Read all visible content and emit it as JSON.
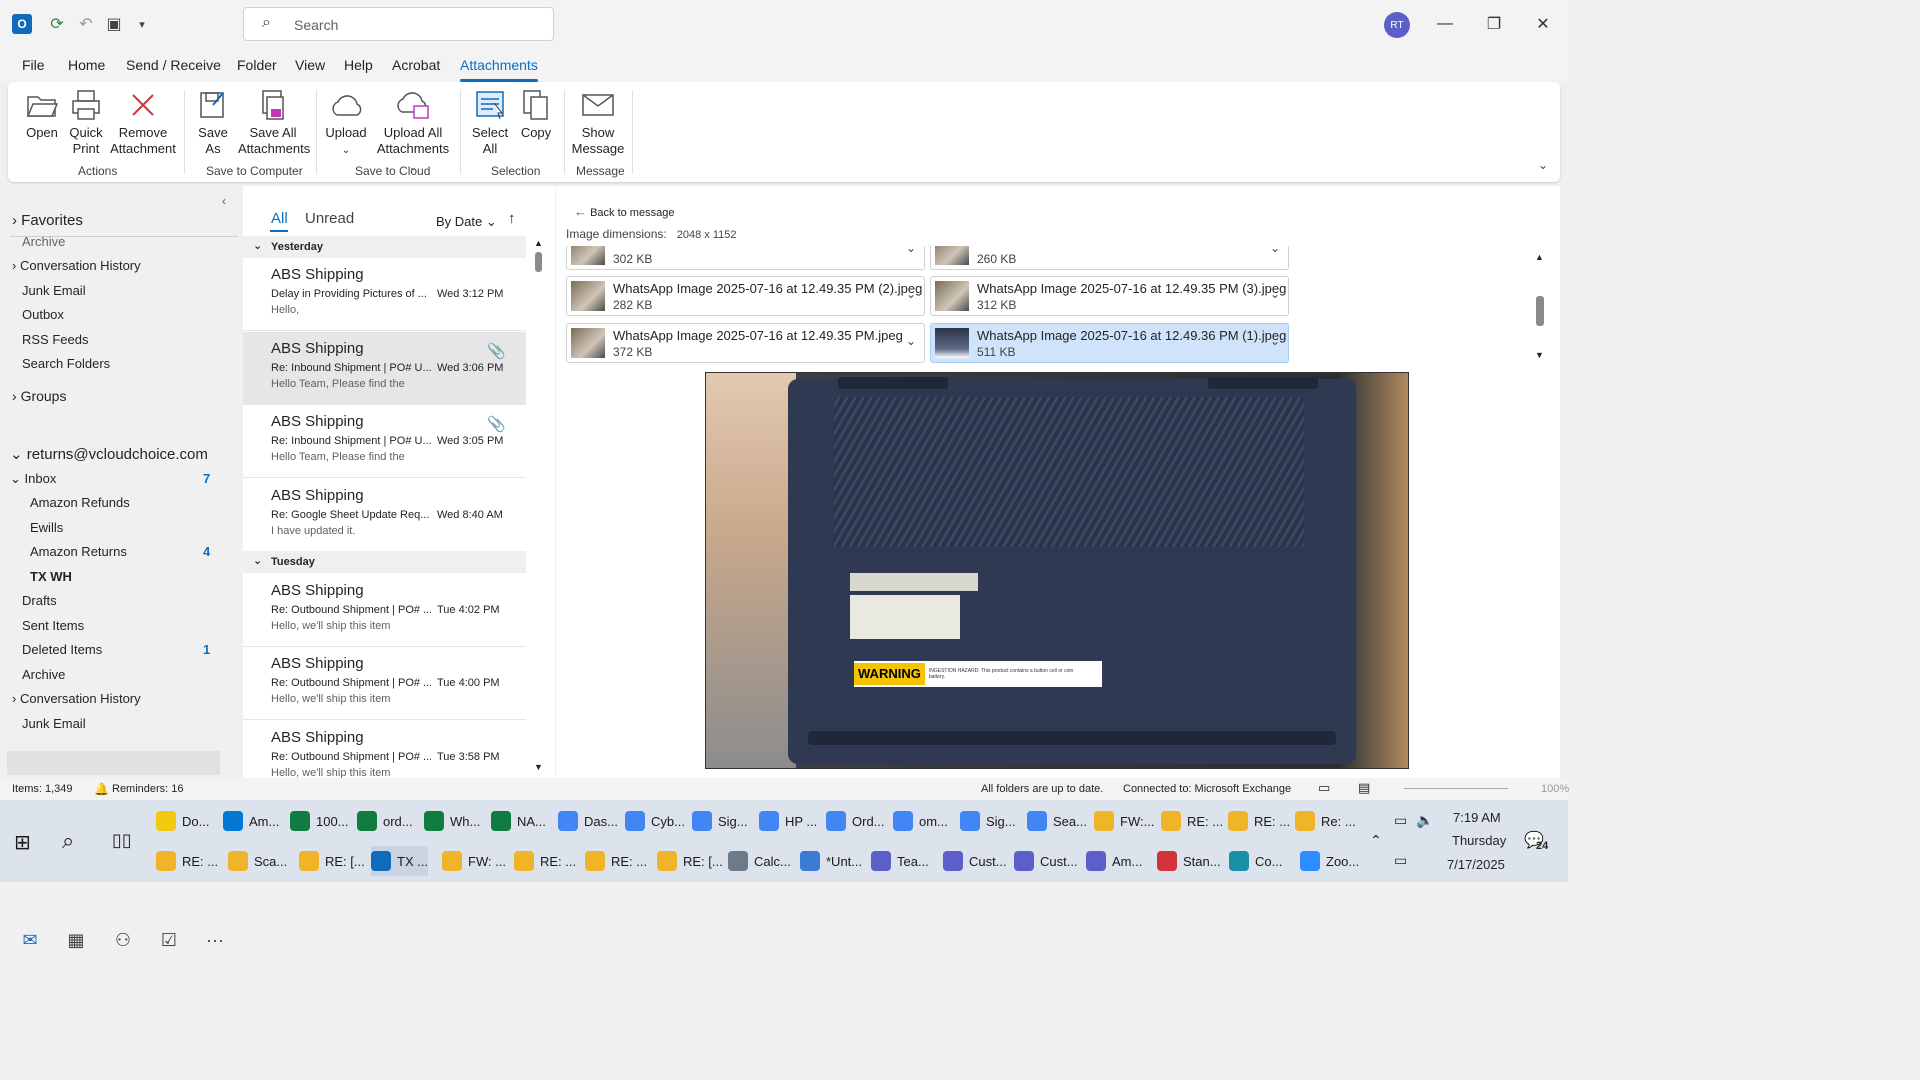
{
  "titlebar": {
    "search_placeholder": "Search",
    "avatar_initials": "RT"
  },
  "menu": {
    "tabs": [
      {
        "label": "File"
      },
      {
        "label": "Home"
      },
      {
        "label": "Send / Receive"
      },
      {
        "label": "Folder"
      },
      {
        "label": "View"
      },
      {
        "label": "Help"
      },
      {
        "label": "Acrobat"
      },
      {
        "label": "Attachments"
      }
    ]
  },
  "ribbon": {
    "open": "Open",
    "quick_print_1": "Quick",
    "quick_print_2": "Print",
    "remove_1": "Remove",
    "remove_2": "Attachment",
    "save_as_1": "Save",
    "save_as_2": "As",
    "save_all_1": "Save All",
    "save_all_2": "Attachments",
    "upload": "Upload",
    "upload_all_1": "Upload All",
    "upload_all_2": "Attachments",
    "select_all_1": "Select",
    "select_all_2": "All",
    "copy": "Copy",
    "show_msg_1": "Show",
    "show_msg_2": "Message",
    "groups": {
      "actions": "Actions",
      "save_computer": "Save to Computer",
      "save_cloud": "Save to Cloud",
      "selection": "Selection",
      "message": "Message"
    }
  },
  "folders": {
    "favorites": "Favorites",
    "archive_top": "Archive",
    "conv_history": "Conversation History",
    "junk": "Junk Email",
    "outbox": "Outbox",
    "rss": "RSS Feeds",
    "search_folders": "Search Folders",
    "groups": "Groups",
    "account": "returns@vcloudchoice.com",
    "inbox": "Inbox",
    "inbox_count": "7",
    "amazon_refunds": "Amazon Refunds",
    "ewills": "Ewills",
    "amazon_returns": "Amazon Returns",
    "amazon_returns_count": "4",
    "tx_wh": "TX WH",
    "drafts": "Drafts",
    "sent": "Sent Items",
    "deleted": "Deleted Items",
    "deleted_count": "1",
    "archive": "Archive",
    "conv_history2": "Conversation History",
    "junk2": "Junk Email"
  },
  "list": {
    "tab_all": "All",
    "tab_unread": "Unread",
    "sort": "By Date",
    "group_yesterday": "Yesterday",
    "group_tuesday": "Tuesday",
    "messages": [
      {
        "from": "ABS Shipping",
        "subject": "Delay in Providing Pictures of ...",
        "date": "Wed 3:12 PM",
        "preview": "Hello,"
      },
      {
        "from": "ABS Shipping",
        "subject": "Re: Inbound Shipment | PO# U...",
        "date": "Wed 3:06 PM",
        "preview": "Hello Team,  Please find the"
      },
      {
        "from": "ABS Shipping",
        "subject": "Re: Inbound Shipment | PO# U...",
        "date": "Wed 3:05 PM",
        "preview": "Hello Team,  Please find the"
      },
      {
        "from": "ABS Shipping",
        "subject": "Re: Google Sheet Update Req...",
        "date": "Wed 8:40 AM",
        "preview": "I have updated it."
      },
      {
        "from": "ABS Shipping",
        "subject": "Re: Outbound Shipment | PO# ...",
        "date": "Tue 4:02 PM",
        "preview": "Hello,  we'll ship this item"
      },
      {
        "from": "ABS Shipping",
        "subject": "Re: Outbound Shipment | PO# ...",
        "date": "Tue 4:00 PM",
        "preview": "Hello,  we'll ship this item"
      },
      {
        "from": "ABS Shipping",
        "subject": "Re: Outbound Shipment | PO# ...",
        "date": "Tue 3:58 PM",
        "preview": "Hello,  we'll ship this item"
      }
    ]
  },
  "reading": {
    "back": "Back to message",
    "dims_label": "Image dimensions:",
    "dims_value": "2048 x 1152",
    "attachments": [
      {
        "name": "",
        "size": "302 KB"
      },
      {
        "name": "",
        "size": "260 KB"
      },
      {
        "name": "WhatsApp Image 2025-07-16 at 12.49.35 PM (2).jpeg",
        "size": "282 KB"
      },
      {
        "name": "WhatsApp Image 2025-07-16 at 12.49.35 PM (3).jpeg",
        "size": "312 KB"
      },
      {
        "name": "WhatsApp Image 2025-07-16 at 12.49.35 PM.jpeg",
        "size": "372 KB"
      },
      {
        "name": "WhatsApp Image 2025-07-16 at 12.49.36 PM (1).jpeg",
        "size": "511 KB"
      }
    ],
    "label_warning": "WARNING",
    "label_hazard": "INGESTION HAZARD: This product contains a button cell or coin battery."
  },
  "status": {
    "items": "Items: 1,349",
    "reminders": "Reminders: 16",
    "sync": "All folders are up to date.",
    "connected": "Connected to: Microsoft Exchange",
    "zoom": "100%"
  },
  "taskbar": {
    "row1": [
      "Do...",
      "Am...",
      "100...",
      "ord...",
      "Wh...",
      "NA...",
      "Das...",
      "Cyb...",
      "Sig...",
      "HP ...",
      "Ord...",
      "om...",
      "Sig...",
      "Sea...",
      "FW:...",
      "RE: ...",
      "RE: ...",
      "Re: ..."
    ],
    "row2": [
      "RE: ...",
      "Sca...",
      "RE: [...",
      "TX ...",
      "FW: ...",
      "RE: ...",
      "RE: ...",
      "RE: [...",
      "Calc...",
      "*Unt...",
      "Tea...",
      "Cust...",
      "Cust...",
      "Am...",
      "Stan...",
      "Co...",
      "Zoo..."
    ],
    "time": "7:19 AM",
    "day": "Thursday",
    "date": "7/17/2025",
    "notif": "24"
  },
  "colors": {
    "accent": "#0f6cbd",
    "selection": "#cfe4fa"
  }
}
